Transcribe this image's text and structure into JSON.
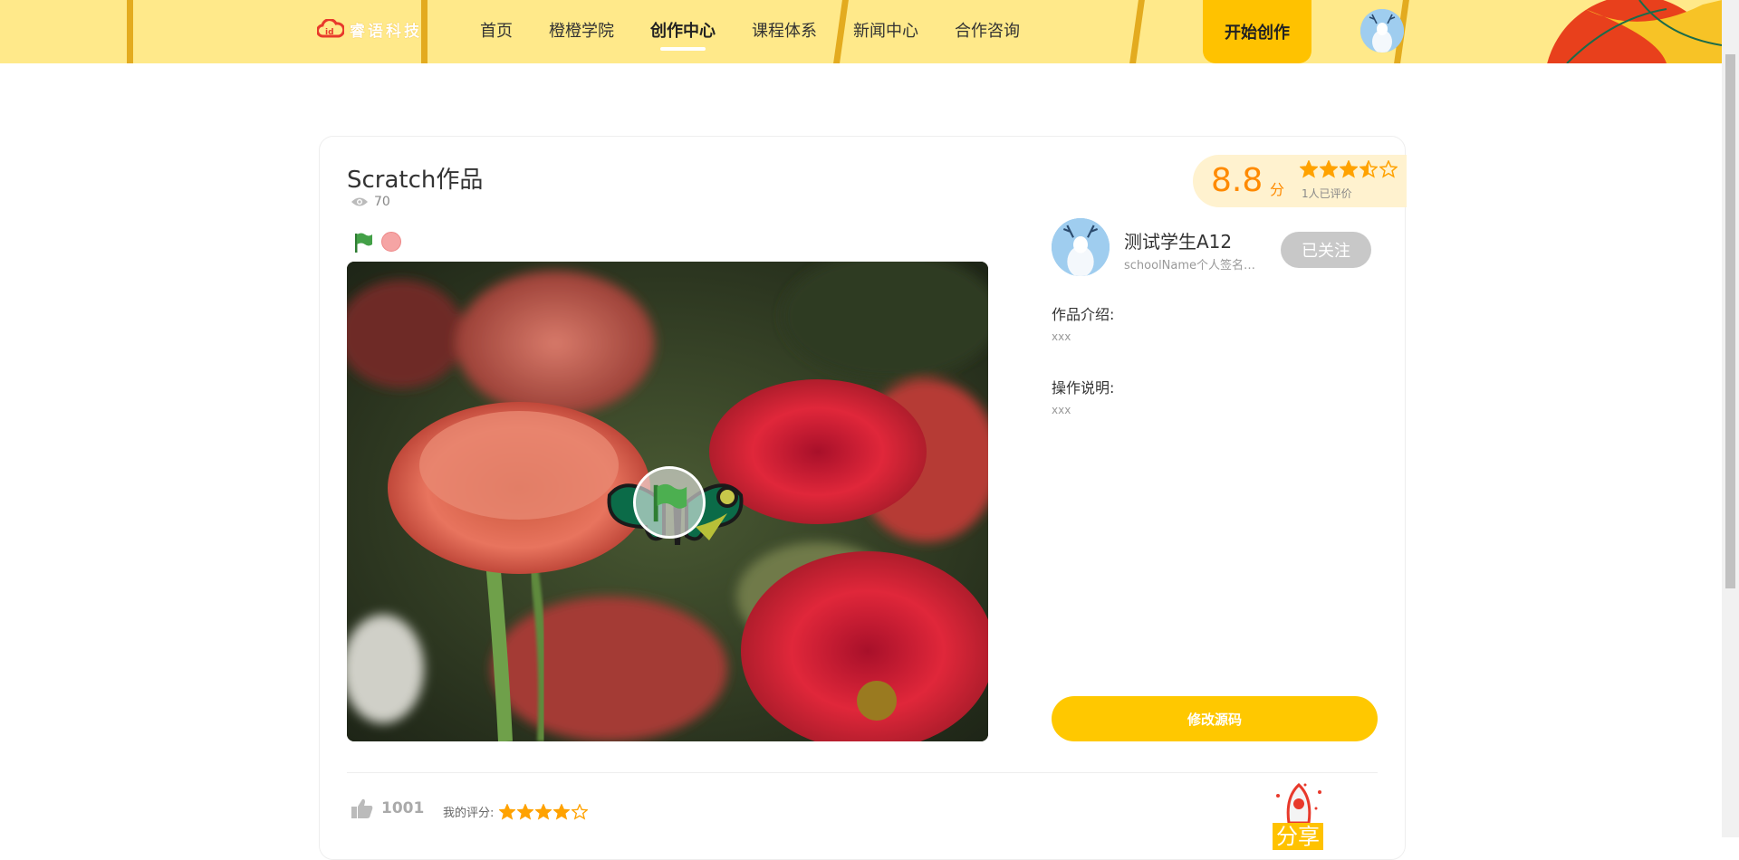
{
  "nav": {
    "logo_text": "睿语科技",
    "items": [
      {
        "label": "首页",
        "active": false
      },
      {
        "label": "橙橙学院",
        "active": false
      },
      {
        "label": "创作中心",
        "active": true
      },
      {
        "label": "课程体系",
        "active": false
      },
      {
        "label": "新闻中心",
        "active": false
      },
      {
        "label": "合作咨询",
        "active": false
      }
    ],
    "start_button": "开始创作"
  },
  "work": {
    "title": "Scratch作品",
    "views": "70"
  },
  "rating": {
    "score": "8.8",
    "unit": "分",
    "stars": 3.5,
    "count_text": "1人已评价"
  },
  "author": {
    "name": "测试学生A12",
    "signature": "schoolName个人签名个人签名",
    "follow_label": "已关注"
  },
  "details": {
    "intro_label": "作品介绍:",
    "intro_value": "xxx",
    "instructions_label": "操作说明:",
    "instructions_value": "xxx"
  },
  "actions": {
    "edit_source": "修改源码",
    "likes": "1001",
    "my_rating_label": "我的评分:",
    "my_rating": 4,
    "share_label": "分享"
  },
  "colors": {
    "topbar": "#ffe98a",
    "accent": "#ffc200",
    "score": "#ff8a00",
    "star": "#ffa200",
    "follow_gray": "#c8c8c8"
  }
}
